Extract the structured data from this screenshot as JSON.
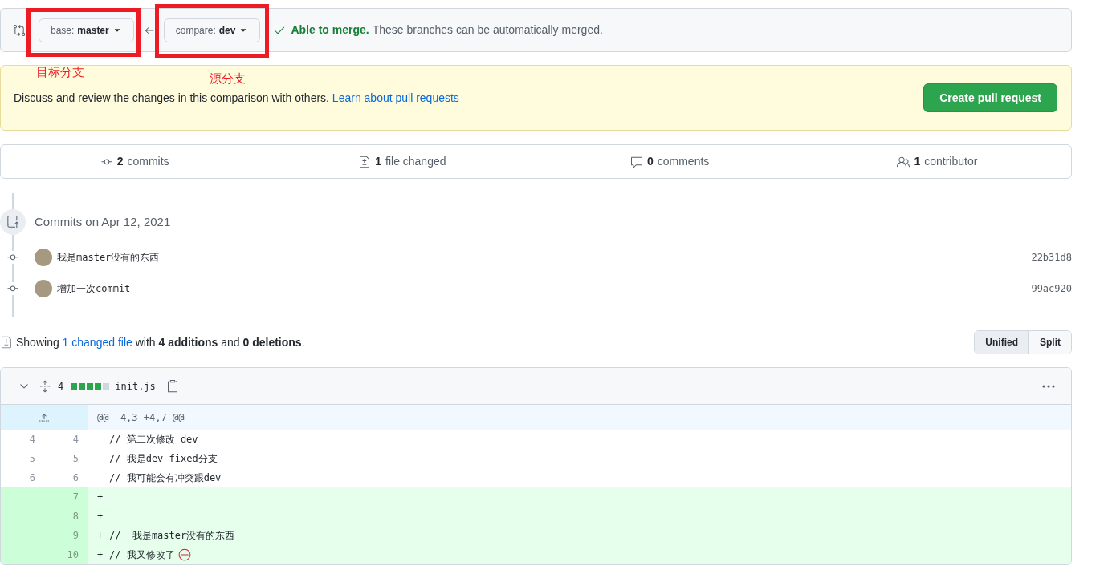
{
  "compare_bar": {
    "base": {
      "label": "base:",
      "value": "master"
    },
    "compare": {
      "label": "compare:",
      "value": "dev"
    },
    "merge_status": {
      "title": "Able to merge.",
      "text": "These branches can be automatically merged."
    }
  },
  "annotations": [
    {
      "label": "目标分支"
    },
    {
      "label": "源分支"
    }
  ],
  "banner": {
    "text": "Discuss and review the changes in this comparison with others.",
    "link": "Learn about pull requests",
    "button": "Create pull request"
  },
  "stats": [
    {
      "kind": "commits",
      "count": "2",
      "label": "commits"
    },
    {
      "kind": "files",
      "count": "1",
      "label": "file changed"
    },
    {
      "kind": "comments",
      "count": "0",
      "label": "comments"
    },
    {
      "kind": "contributors",
      "count": "1",
      "label": "contributor"
    }
  ],
  "commits": {
    "title": "Commits on Apr 12, 2021",
    "items": [
      {
        "message": "我是master没有的东西",
        "sha": "22b31d8"
      },
      {
        "message": "增加一次commit",
        "sha": "99ac920"
      }
    ]
  },
  "summary": {
    "prefix": "Showing",
    "link": "1 changed file",
    "suffix": "with **4 additions** and **0 deletions**."
  },
  "view_toggle": [
    {
      "label": "Unified",
      "selected": true
    },
    {
      "label": "Split",
      "selected": false
    }
  ],
  "file": {
    "additions": "4",
    "diffstat": [
      {
        "color": "#2da44e"
      },
      {
        "color": "#2da44e"
      },
      {
        "color": "#2da44e"
      },
      {
        "color": "#2da44e"
      },
      {
        "color": "#d0d7de"
      }
    ],
    "name": "init.js",
    "hunk": "@@ -4,3 +4,7 @@",
    "lines": [
      {
        "kind": "context",
        "old": "4",
        "new": "4",
        "code": "// 第二次修改 dev",
        "no_newline": false
      },
      {
        "kind": "context",
        "old": "5",
        "new": "5",
        "code": "// 我是dev-fixed分支",
        "no_newline": false
      },
      {
        "kind": "context",
        "old": "6",
        "new": "6",
        "code": "// 我可能会有冲突跟dev",
        "no_newline": false
      },
      {
        "kind": "addition",
        "new": "7",
        "marker": "+",
        "no_newline": false
      },
      {
        "kind": "addition",
        "new": "8",
        "marker": "+",
        "no_newline": false
      },
      {
        "kind": "addition",
        "new": "9",
        "marker": "+",
        "code": "//  我是master没有的东西",
        "no_newline": false
      },
      {
        "kind": "addition",
        "new": "10",
        "marker": "+",
        "code": "// 我又修改了",
        "no_newline": true
      }
    ]
  }
}
